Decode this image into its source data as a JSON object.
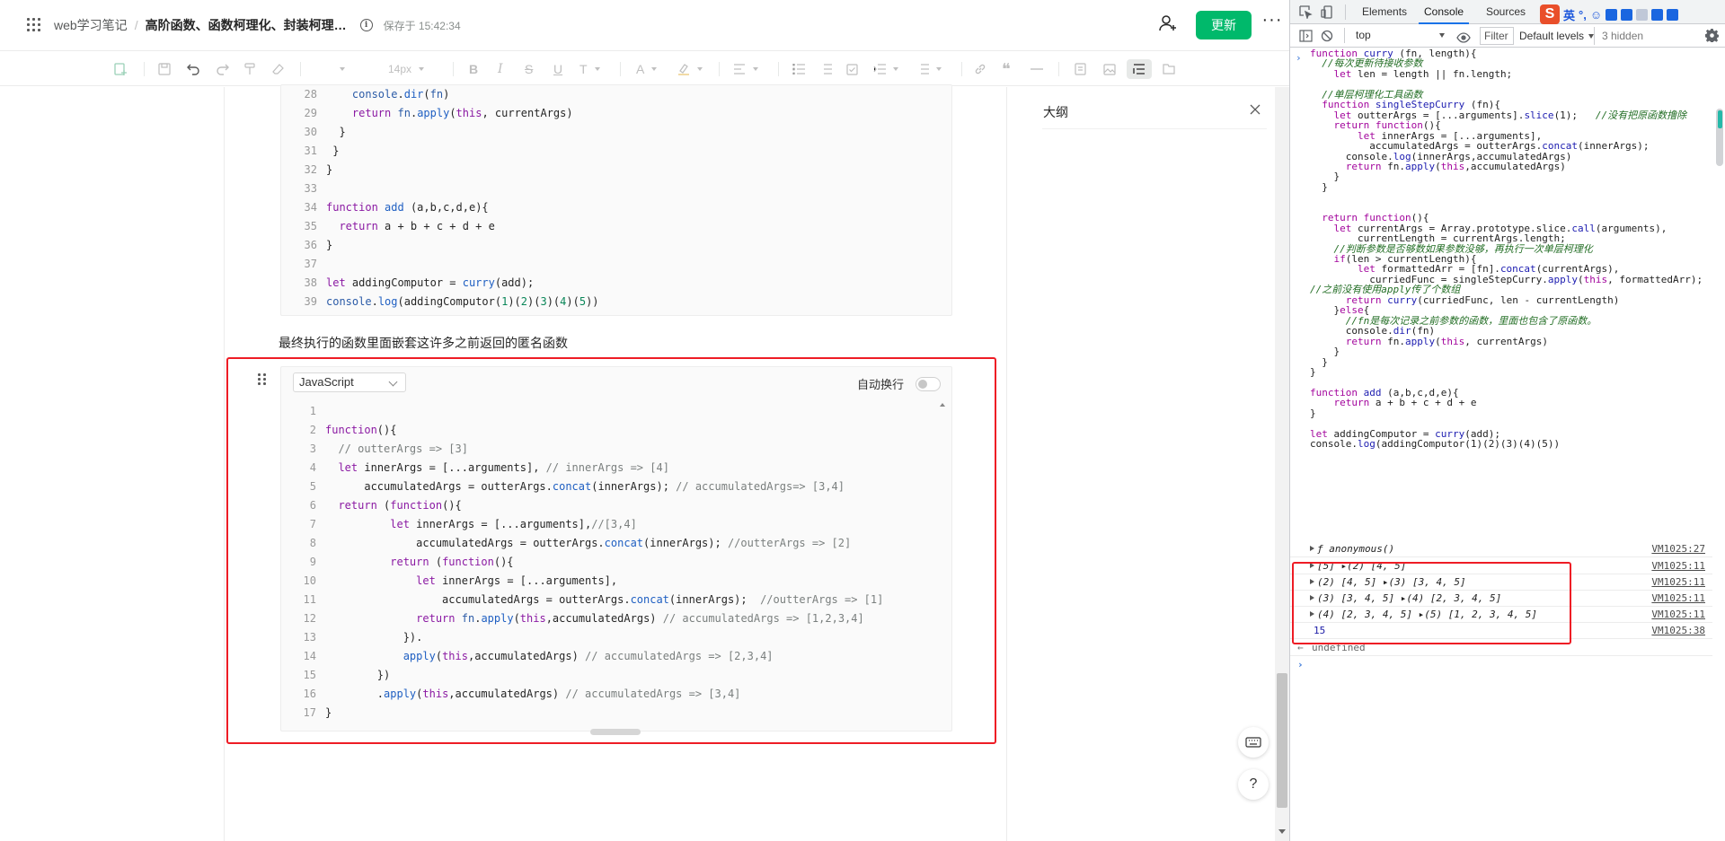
{
  "header": {
    "book": "web学习笔记",
    "separator": "/",
    "doc_title": "高阶函数、函数柯理化、封装柯理化工具函数",
    "saved": "保存于 15:42:34",
    "update_label": "更新",
    "more_label": "···"
  },
  "toolbar": {
    "font_size": "14px"
  },
  "editor": {
    "paragraph": "最终执行的函数里面嵌套这许多之前返回的匿名函数",
    "language": "JavaScript",
    "wrap_label": "自动换行",
    "block1_lines": [
      {
        "n": "28",
        "code": "    console.dir(fn)"
      },
      {
        "n": "29",
        "code": "    return fn.apply(this, currentArgs)"
      },
      {
        "n": "30",
        "code": "  }"
      },
      {
        "n": "31",
        "code": " }"
      },
      {
        "n": "32",
        "code": "}"
      },
      {
        "n": "33",
        "code": ""
      },
      {
        "n": "34",
        "code": "function add (a,b,c,d,e){"
      },
      {
        "n": "35",
        "code": "  return a + b + c + d + e"
      },
      {
        "n": "36",
        "code": "}"
      },
      {
        "n": "37",
        "code": ""
      },
      {
        "n": "38",
        "code": "let addingComputor = curry(add);"
      },
      {
        "n": "39",
        "code": "console.log(addingComputor(1)(2)(3)(4)(5))"
      }
    ],
    "block2_lines": [
      {
        "n": "1",
        "code": ""
      },
      {
        "n": "2",
        "code": "function(){"
      },
      {
        "n": "3",
        "code": "  // outterArgs => [3]"
      },
      {
        "n": "4",
        "code": "  let innerArgs = [...arguments], // innerArgs => [4]"
      },
      {
        "n": "5",
        "code": "      accumulatedArgs = outterArgs.concat(innerArgs); // accumulatedArgs=> [3,4]"
      },
      {
        "n": "6",
        "code": "  return (function(){"
      },
      {
        "n": "7",
        "code": "          let innerArgs = [...arguments],//[3,4]"
      },
      {
        "n": "8",
        "code": "              accumulatedArgs = outterArgs.concat(innerArgs); //outterArgs => [2]"
      },
      {
        "n": "9",
        "code": "          return (function(){"
      },
      {
        "n": "10",
        "code": "              let innerArgs = [...arguments],"
      },
      {
        "n": "11",
        "code": "                  accumulatedArgs = outterArgs.concat(innerArgs);  //outterArgs => [1]"
      },
      {
        "n": "12",
        "code": "              return fn.apply(this,accumulatedArgs) // accumulatedArgs => [1,2,3,4]"
      },
      {
        "n": "13",
        "code": "            })."
      },
      {
        "n": "14",
        "code": "            apply(this,accumulatedArgs) // accumulatedArgs => [2,3,4]"
      },
      {
        "n": "15",
        "code": "        })"
      },
      {
        "n": "16",
        "code": "        .apply(this,accumulatedArgs) // accumulatedArgs => [3,4]"
      },
      {
        "n": "17",
        "code": "}"
      }
    ]
  },
  "outline": {
    "title": "大纲"
  },
  "devtools": {
    "tabs": [
      "Elements",
      "Console",
      "Sources"
    ],
    "active_tab": "Console",
    "context": "top",
    "filter_placeholder": "Filter",
    "levels": "Default levels",
    "hidden": "3 hidden",
    "ime_label": "英",
    "source_lines": [
      "function curry (fn, length){",
      "  //每次更新待接收参数",
      "    let len = length || fn.length;",
      "",
      "  //单层柯理化工具函数",
      "  function singleStepCurry (fn){",
      "    let outterArgs = [...arguments].slice(1);   //没有把原函数撸除",
      "    return function(){",
      "        let innerArgs = [...arguments],",
      "          accumulatedArgs = outterArgs.concat(innerArgs);",
      "      console.log(innerArgs,accumulatedArgs)",
      "      return fn.apply(this,accumulatedArgs)",
      "    }",
      "  }",
      "",
      "",
      "  return function(){",
      "    let currentArgs = Array.prototype.slice.call(arguments),",
      "        currentLength = currentArgs.length;",
      "    //判断参数是否够数如果参数没够，再执行一次单层柯理化",
      "    if(len > currentLength){",
      "        let formattedArr = [fn].concat(currentArgs),",
      "          curriedFunc = singleStepCurry.apply(this, formattedArr);",
      "//之前没有使用apply传了个数组",
      "      return curry(curriedFunc, len - currentLength)",
      "    }else{",
      "      //fn是每次记录之前参数的函数，里面也包含了原函数。",
      "      console.dir(fn)",
      "      return fn.apply(this, currentArgs)",
      "    }",
      "  }",
      "}",
      "",
      "function add (a,b,c,d,e){",
      "    return a + b + c + d + e",
      "}",
      "",
      "let addingComputor = curry(add);",
      "console.log(addingComputor(1)(2)(3)(4)(5))"
    ],
    "logs": [
      {
        "text": "ƒ anonymous()",
        "src": "VM1025:27"
      },
      {
        "text": "[5] ▸(2) [4, 5]",
        "src": "VM1025:11"
      },
      {
        "text": "(2) [4, 5] ▸(3) [3, 4, 5]",
        "src": "VM1025:11"
      },
      {
        "text": "(3) [3, 4, 5] ▸(4) [2, 3, 4, 5]",
        "src": "VM1025:11"
      },
      {
        "text": "(4) [2, 3, 4, 5] ▸(5) [1, 2, 3, 4, 5]",
        "src": "VM1025:11"
      }
    ],
    "result": "15",
    "result_src": "VM1025:38",
    "undefined_label": "undefined",
    "return_marker": "←",
    "input_prompt": "›",
    "cmd_prompt": "›"
  },
  "colors": {
    "accent_green": "#00b96b",
    "highlight_red": "#ee1c25",
    "devtools_blue": "#1a73e8"
  }
}
